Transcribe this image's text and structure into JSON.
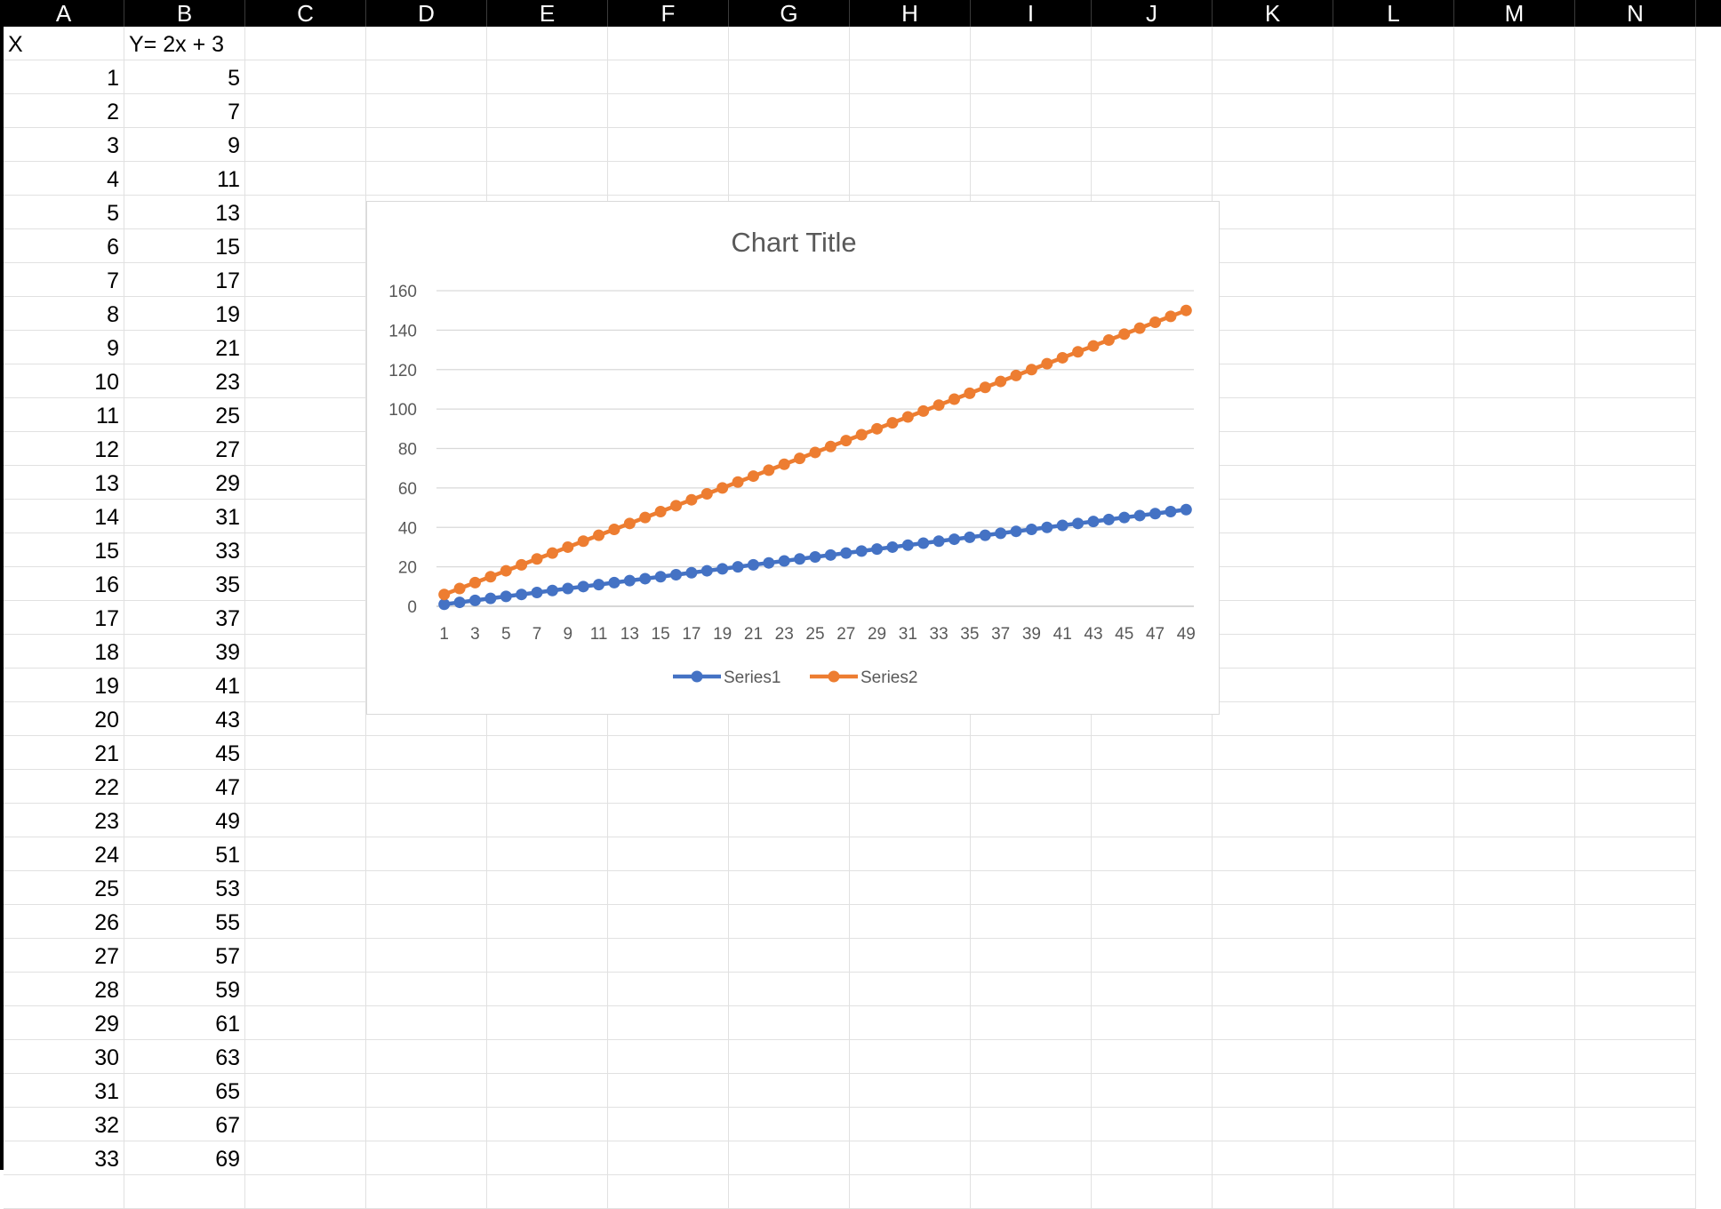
{
  "columns": [
    "A",
    "B",
    "C",
    "D",
    "E",
    "F",
    "G",
    "H",
    "I",
    "J",
    "K",
    "L",
    "M",
    "N"
  ],
  "header_row": {
    "x_label": "X",
    "y_label": "Y= 2x + 3"
  },
  "rows": [
    [
      1,
      5
    ],
    [
      2,
      7
    ],
    [
      3,
      9
    ],
    [
      4,
      11
    ],
    [
      5,
      13
    ],
    [
      6,
      15
    ],
    [
      7,
      17
    ],
    [
      8,
      19
    ],
    [
      9,
      21
    ],
    [
      10,
      23
    ],
    [
      11,
      25
    ],
    [
      12,
      27
    ],
    [
      13,
      29
    ],
    [
      14,
      31
    ],
    [
      15,
      33
    ],
    [
      16,
      35
    ],
    [
      17,
      37
    ],
    [
      18,
      39
    ],
    [
      19,
      41
    ],
    [
      20,
      43
    ],
    [
      21,
      45
    ],
    [
      22,
      47
    ],
    [
      23,
      49
    ],
    [
      24,
      51
    ],
    [
      25,
      53
    ],
    [
      26,
      55
    ],
    [
      27,
      57
    ],
    [
      28,
      59
    ],
    [
      29,
      61
    ],
    [
      30,
      63
    ],
    [
      31,
      65
    ],
    [
      32,
      67
    ],
    [
      33,
      69
    ]
  ],
  "colors": {
    "series1": "#4472C4",
    "series2": "#ED7D31",
    "gridline": "#d9d9d9",
    "header_bg": "#000000"
  },
  "chart_data": {
    "type": "line",
    "title": "Chart Title",
    "categories": [
      1,
      2,
      3,
      4,
      5,
      6,
      7,
      8,
      9,
      10,
      11,
      12,
      13,
      14,
      15,
      16,
      17,
      18,
      19,
      20,
      21,
      22,
      23,
      24,
      25,
      26,
      27,
      28,
      29,
      30,
      31,
      32,
      33,
      34,
      35,
      36,
      37,
      38,
      39,
      40,
      41,
      42,
      43,
      44,
      45,
      46,
      47,
      48,
      49
    ],
    "x_tick_labels": [
      "1",
      "3",
      "5",
      "7",
      "9",
      "11",
      "13",
      "15",
      "17",
      "19",
      "21",
      "23",
      "25",
      "27",
      "29",
      "31",
      "33",
      "35",
      "37",
      "39",
      "41",
      "43",
      "45",
      "47",
      "49"
    ],
    "y_tick_labels": [
      "0",
      "20",
      "40",
      "60",
      "80",
      "100",
      "120",
      "140",
      "160"
    ],
    "ylim": [
      0,
      160
    ],
    "grid": true,
    "legend_position": "bottom",
    "series": [
      {
        "name": "Series1",
        "color": "#4472C4",
        "values": [
          1,
          2,
          3,
          4,
          5,
          6,
          7,
          8,
          9,
          10,
          11,
          12,
          13,
          14,
          15,
          16,
          17,
          18,
          19,
          20,
          21,
          22,
          23,
          24,
          25,
          26,
          27,
          28,
          29,
          30,
          31,
          32,
          33,
          34,
          35,
          36,
          37,
          38,
          39,
          40,
          41,
          42,
          43,
          44,
          45,
          46,
          47,
          48,
          49
        ]
      },
      {
        "name": "Series2",
        "color": "#ED7D31",
        "values": [
          6,
          9,
          12,
          15,
          18,
          21,
          24,
          27,
          30,
          33,
          36,
          39,
          42,
          45,
          48,
          51,
          54,
          57,
          60,
          63,
          66,
          69,
          72,
          75,
          78,
          81,
          84,
          87,
          90,
          93,
          96,
          99,
          102,
          105,
          108,
          111,
          114,
          117,
          120,
          123,
          126,
          129,
          132,
          135,
          138,
          141,
          144,
          147,
          150
        ]
      }
    ]
  }
}
